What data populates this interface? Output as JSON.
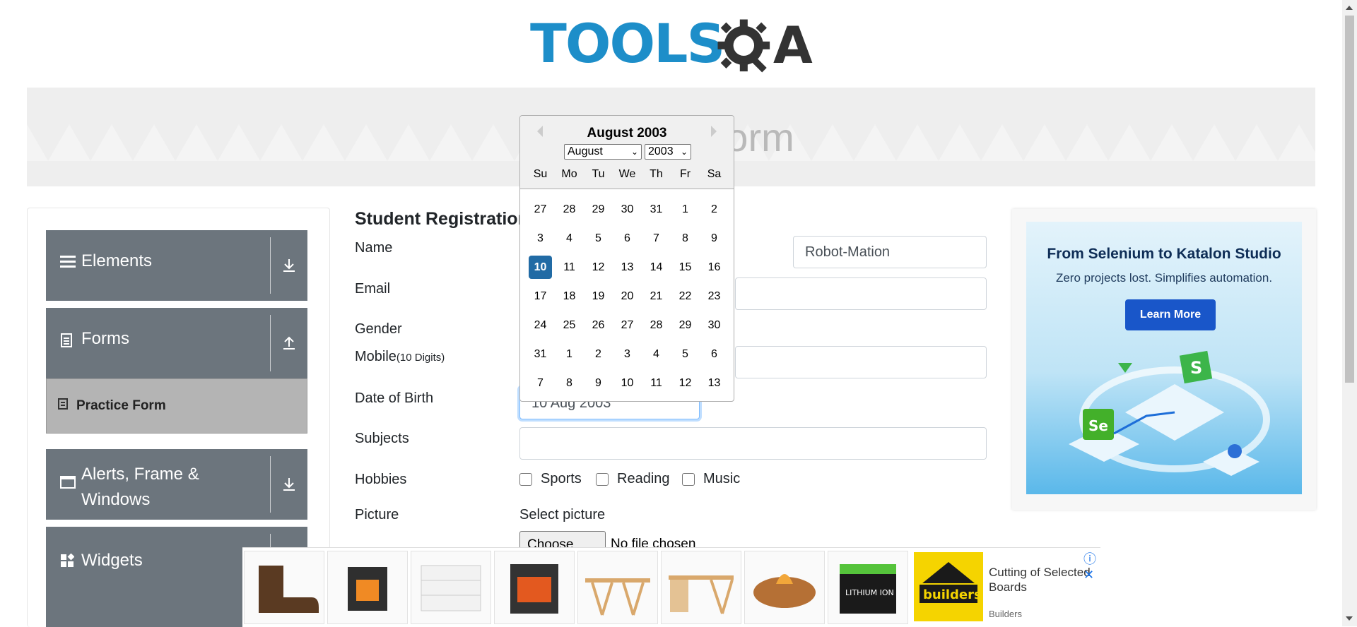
{
  "header": {
    "logo_text": "TOOLS",
    "logo_suffix": "A"
  },
  "banner": {
    "title": "Practice Form"
  },
  "sidebar": {
    "groups": [
      {
        "label": "Elements",
        "icon": "menu-icon",
        "arrow": "download-arrow-icon"
      },
      {
        "label": "Forms",
        "icon": "document-icon",
        "arrow": "upload-arrow-icon"
      },
      {
        "label": "Alerts, Frame & Windows",
        "icon": "window-icon",
        "arrow": "download-arrow-icon"
      },
      {
        "label": "Widgets",
        "icon": "widgets-icon",
        "arrow": "download-arrow-icon"
      }
    ],
    "active_item": "Practice Form"
  },
  "form": {
    "title": "Student Registration Form",
    "name_label": "Name",
    "last_name_value": "Robot-Mation",
    "email_label": "Email",
    "gender_label": "Gender",
    "mobile_label": "Mobile",
    "mobile_hint": "(10 Digits)",
    "dob_label": "Date of Birth",
    "dob_value": "10 Aug 2003",
    "subjects_label": "Subjects",
    "hobbies_label": "Hobbies",
    "hobbies": [
      "Sports",
      "Reading",
      "Music"
    ],
    "picture_label": "Picture",
    "select_picture": "Select picture",
    "choose_file": "Choose File",
    "no_file": "No file chosen"
  },
  "datepicker": {
    "title": "August 2003",
    "month_select": "August",
    "year_select": "2003",
    "weekdays": [
      "Su",
      "Mo",
      "Tu",
      "We",
      "Th",
      "Fr",
      "Sa"
    ],
    "weeks": [
      [
        "27",
        "28",
        "29",
        "30",
        "31",
        "1",
        "2"
      ],
      [
        "3",
        "4",
        "5",
        "6",
        "7",
        "8",
        "9"
      ],
      [
        "10",
        "11",
        "12",
        "13",
        "14",
        "15",
        "16"
      ],
      [
        "17",
        "18",
        "19",
        "20",
        "21",
        "22",
        "23"
      ],
      [
        "24",
        "25",
        "26",
        "27",
        "28",
        "29",
        "30"
      ],
      [
        "31",
        "1",
        "2",
        "3",
        "4",
        "5",
        "6"
      ],
      [
        "7",
        "8",
        "9",
        "10",
        "11",
        "12",
        "13"
      ]
    ],
    "selected_day": "10"
  },
  "ad_right": {
    "title": "From Selenium to Katalon Studio",
    "subtitle": "Zero projects lost. Simplifies automation.",
    "button": "Learn More"
  },
  "ad_bottom": {
    "headline": "Cutting of Selected Boards",
    "brand": "Builders",
    "logo_text": "builders",
    "battery_label": "LITHIUM ION"
  },
  "colors": {
    "accent": "#1d8ec9",
    "sidebar": "#6c757d",
    "selected_day": "#216ba5"
  }
}
